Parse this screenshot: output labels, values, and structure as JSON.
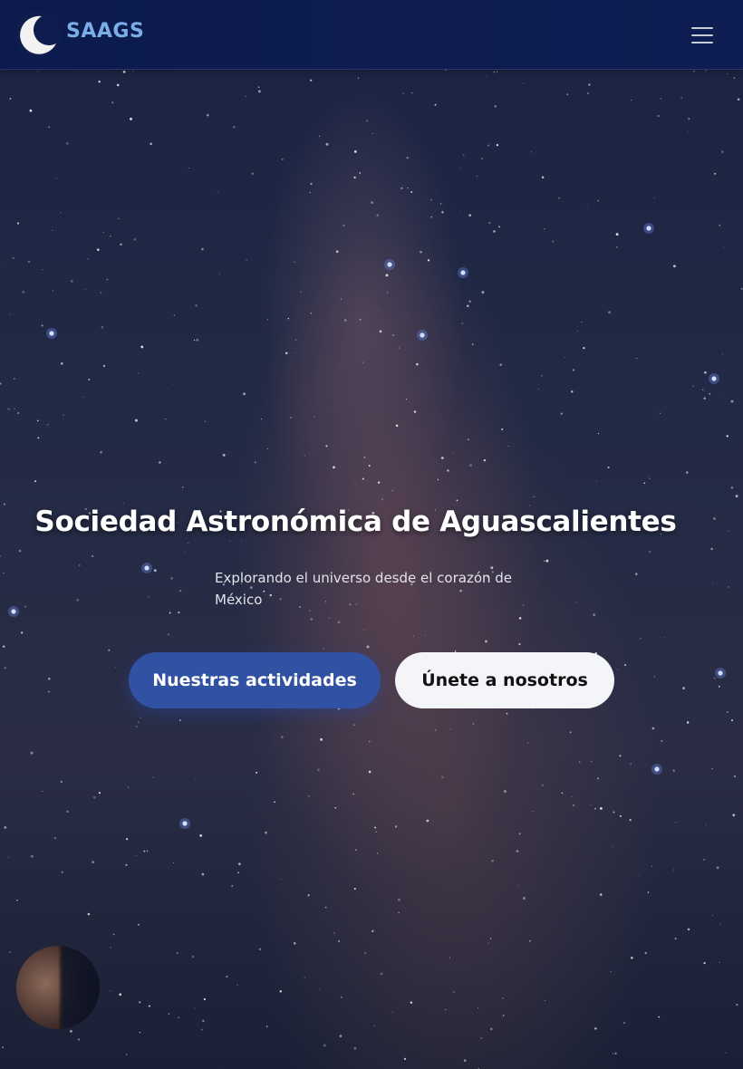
{
  "navbar": {
    "brand": "SAAGS",
    "logo_icon": "moon-icon",
    "menu_icon": "hamburger-menu-icon"
  },
  "hero": {
    "title": "Sociedad Astronómica de Aguascalientes",
    "subtitle": "Explorando el universo desde el corazón de México",
    "primary_button": "Nuestras actividades",
    "secondary_button": "Únete a nosotros",
    "planet_icon": "planet-icon"
  },
  "colors": {
    "navbar_bg": "#0c1a4d",
    "brand": "#7aaee6",
    "primary_button": "#3152a3",
    "secondary_button": "#f4f5f8"
  }
}
